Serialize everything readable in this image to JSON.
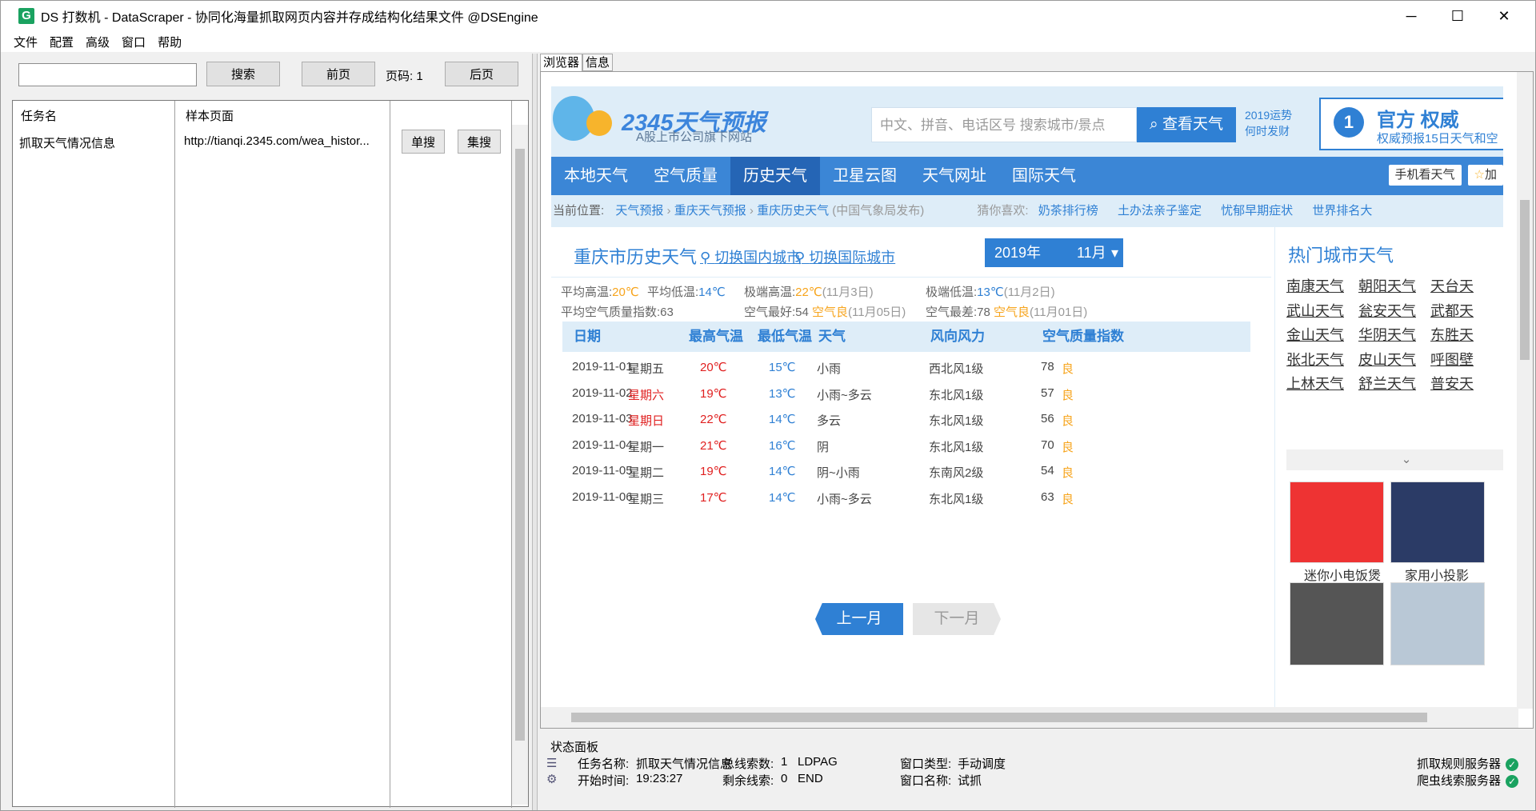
{
  "window": {
    "title": "DS 打数机 - DataScraper - 协同化海量抓取网页内容并存成结构化结果文件 @DSEngine",
    "app_icon": "G"
  },
  "menu": [
    "文件",
    "配置",
    "高级",
    "窗口",
    "帮助"
  ],
  "left": {
    "search_value": "",
    "search_btn": "搜索",
    "prev_btn": "前页",
    "page_label": "页码:",
    "page_num": "1",
    "next_btn": "后页",
    "col_task": "任务名",
    "col_sample": "样本页面",
    "row": {
      "task": "抓取天气情况信息",
      "url": "http://tianqi.2345.com/wea_histor...",
      "single": "单搜",
      "batch": "集搜"
    }
  },
  "tabs": [
    "浏览器",
    "信息"
  ],
  "site": {
    "logo": "2345天气预报",
    "logo_sub": "A股上市公司旗下网站",
    "search_ph": "中文、拼音、电话区号  搜索城市/景点",
    "search_btn": "查看天气",
    "note1": "2019运势",
    "note2": "何时发财",
    "auth_title": "官方  权威",
    "auth_sub": "权威预报15日天气和空",
    "medal": "1",
    "nav": [
      "本地天气",
      "空气质量",
      "历史天气",
      "卫星云图",
      "天气网址",
      "国际天气"
    ],
    "mobile": "手机看天气",
    "fav": "加",
    "crumb": {
      "label": "当前位置:",
      "c1": "天气预报",
      "c2": "重庆天气预报",
      "c3": "重庆历史天气",
      "note": "(中国气象局发布)",
      "guess": "猜你喜欢:",
      "g1": "奶茶排行榜",
      "g2": "土办法亲子鉴定",
      "g3": "忧郁早期症状",
      "g4": "世界排名大"
    },
    "city_title": "重庆市历史天气",
    "switch_dom": "切换国内城市",
    "switch_intl": "切换国际城市",
    "year": "2019年",
    "month": "11月",
    "stats": {
      "avg_high_l": "平均高温:",
      "avg_high": "20℃",
      "avg_low_l": "平均低温:",
      "avg_low": "14℃",
      "ext_high_l": "极端高温:",
      "ext_high": "22℃",
      "ext_high_d": "(11月3日)",
      "ext_low_l": "极端低温:",
      "ext_low": "13℃",
      "ext_low_d": "(11月2日)",
      "aqi_avg_l": "平均空气质量指数:",
      "aqi_avg": "63",
      "best_l": "空气最好:",
      "best": "54",
      "best_q": "空气良",
      "best_d": "(11月05日)",
      "worst_l": "空气最差:",
      "worst": "78",
      "worst_q": "空气良",
      "worst_d": "(11月01日)"
    },
    "table": {
      "headers": [
        "日期",
        "最高气温",
        "最低气温",
        "天气",
        "风向风力",
        "空气质量指数"
      ],
      "rows": [
        {
          "date": "2019-11-01",
          "wd": "星期五",
          "hi": "20℃",
          "lo": "15℃",
          "w": "小雨",
          "wind": "西北风1级",
          "aqi": "78",
          "q": "良"
        },
        {
          "date": "2019-11-02",
          "wd": "星期六",
          "hi": "19℃",
          "lo": "13℃",
          "w": "小雨~多云",
          "wind": "东北风1级",
          "aqi": "57",
          "q": "良"
        },
        {
          "date": "2019-11-03",
          "wd": "星期日",
          "hi": "22℃",
          "lo": "14℃",
          "w": "多云",
          "wind": "东北风1级",
          "aqi": "56",
          "q": "良"
        },
        {
          "date": "2019-11-04",
          "wd": "星期一",
          "hi": "21℃",
          "lo": "16℃",
          "w": "阴",
          "wind": "东北风1级",
          "aqi": "70",
          "q": "良"
        },
        {
          "date": "2019-11-05",
          "wd": "星期二",
          "hi": "19℃",
          "lo": "14℃",
          "w": "阴~小雨",
          "wind": "东南风2级",
          "aqi": "54",
          "q": "良"
        },
        {
          "date": "2019-11-06",
          "wd": "星期三",
          "hi": "17℃",
          "lo": "14℃",
          "w": "小雨~多云",
          "wind": "东北风1级",
          "aqi": "63",
          "q": "良"
        }
      ]
    },
    "prev_month": "上一月",
    "next_month": "下一月",
    "hot_title": "热门城市天气",
    "hot_cities": [
      "南康天气",
      "朝阳天气",
      "天台天",
      "武山天气",
      "瓮安天气",
      "武都天",
      "金山天气",
      "华阴天气",
      "东胜天",
      "张北天气",
      "皮山天气",
      "呼图壁",
      "上林天气",
      "舒兰天气",
      "普安天"
    ],
    "products": [
      "迷你小电饭煲",
      "家用小投影"
    ]
  },
  "status": {
    "title": "状态面板",
    "task_l": "任务名称:",
    "task": "抓取天气情况信息",
    "start_l": "开始时间:",
    "start": "19:23:27",
    "total_l": "总线索数:",
    "total": "1",
    "total_s": "LDPAG",
    "remain_l": "剩余线索:",
    "remain": "0",
    "remain_s": "END",
    "wtype_l": "窗口类型:",
    "wtype": "手动调度",
    "wname_l": "窗口名称:",
    "wname": "试抓",
    "srv1": "抓取规则服务器",
    "srv2": "爬虫线索服务器"
  }
}
